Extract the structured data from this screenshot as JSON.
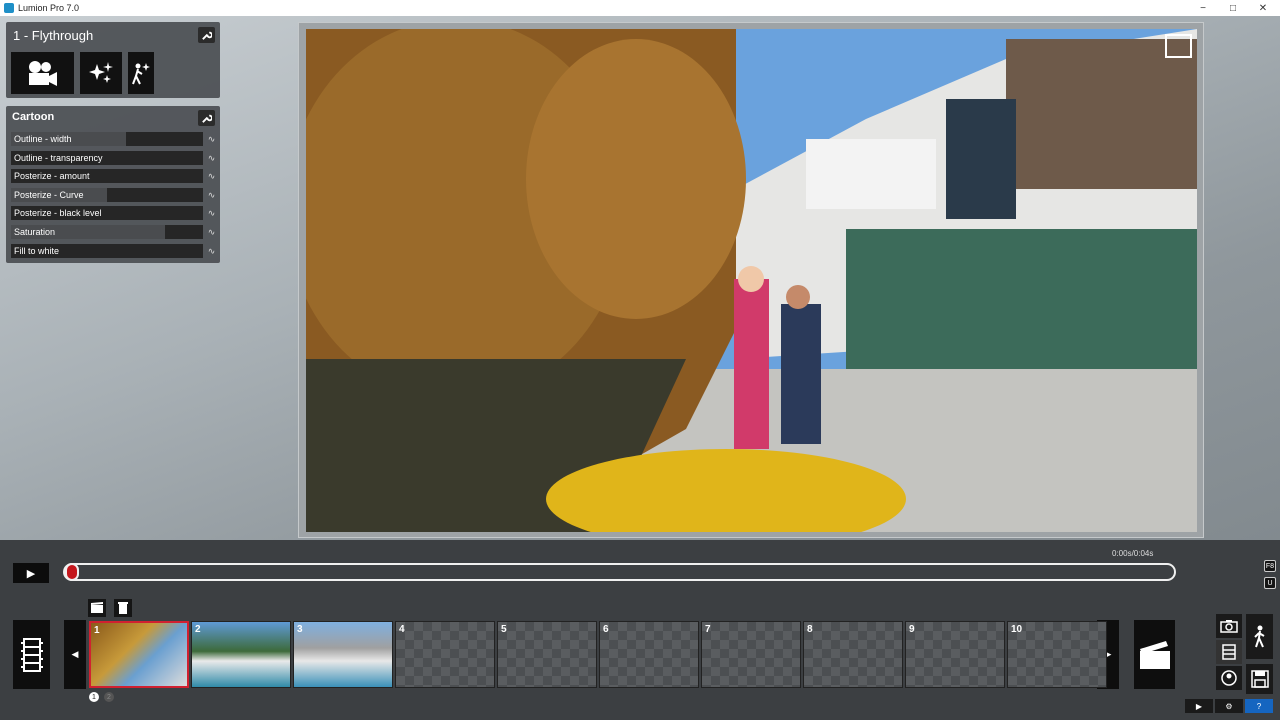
{
  "app": {
    "title": "Lumion Pro 7.0",
    "minimize": "−",
    "maximize": "□",
    "close": "✕"
  },
  "movie_panel": {
    "title": "1 - Flythrough",
    "fx_buttons": [
      {
        "icon": "movie-camera-icon"
      },
      {
        "icon": "sparkle-effects-icon"
      },
      {
        "icon": "walk-sparkle-icon"
      }
    ]
  },
  "effect_panel": {
    "title": "Cartoon",
    "sliders": [
      {
        "label": "Outline - width",
        "value": 0.6
      },
      {
        "label": "Outline - transparency",
        "value": 0.0
      },
      {
        "label": "Posterize - amount",
        "value": 0.0
      },
      {
        "label": "Posterize - Curve",
        "value": 0.5
      },
      {
        "label": "Posterize - black level",
        "value": 0.0
      },
      {
        "label": "Saturation",
        "value": 0.8
      },
      {
        "label": "Fill to white",
        "value": 0.0
      }
    ],
    "curve_glyph": "∿"
  },
  "playback": {
    "play": "▶",
    "time": "0:00s/0:04s",
    "progress": 0.0
  },
  "keys": {
    "f8": "F8",
    "u": "U"
  },
  "clip_tools": {
    "add_icon": "add-clip-icon",
    "delete_icon": "trash-icon"
  },
  "nav": {
    "prev": "◀",
    "next": "▶"
  },
  "clips": [
    {
      "num": "1",
      "filled": true,
      "selected": true
    },
    {
      "num": "2",
      "filled": true,
      "selected": false
    },
    {
      "num": "3",
      "filled": true,
      "selected": false
    },
    {
      "num": "4",
      "filled": false,
      "selected": false
    },
    {
      "num": "5",
      "filled": false,
      "selected": false
    },
    {
      "num": "6",
      "filled": false,
      "selected": false
    },
    {
      "num": "7",
      "filled": false,
      "selected": false
    },
    {
      "num": "8",
      "filled": false,
      "selected": false
    },
    {
      "num": "9",
      "filled": false,
      "selected": false
    },
    {
      "num": "10",
      "filled": false,
      "selected": false
    }
  ],
  "pages": [
    "1",
    "2"
  ],
  "bottom_right": {
    "play": "▶",
    "settings": "⚙",
    "help": "?"
  },
  "colors": {
    "accent_red": "#d12030",
    "help_blue": "#1565c0"
  }
}
